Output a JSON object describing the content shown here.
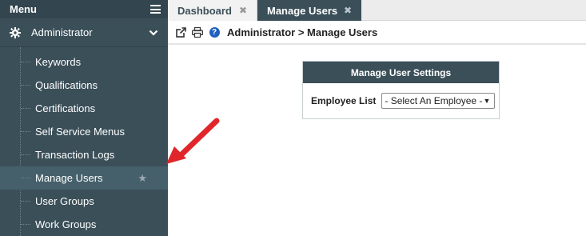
{
  "sidebar": {
    "title": "Menu",
    "section": "Administrator",
    "items": [
      {
        "label": "Keywords"
      },
      {
        "label": "Qualifications"
      },
      {
        "label": "Certifications"
      },
      {
        "label": "Self Service Menus"
      },
      {
        "label": "Transaction Logs"
      },
      {
        "label": "Manage Users",
        "active": true,
        "starred": true
      },
      {
        "label": "User Groups"
      },
      {
        "label": "Work Groups"
      }
    ]
  },
  "tabs": [
    {
      "label": "Dashboard",
      "active": false
    },
    {
      "label": "Manage Users",
      "active": true
    }
  ],
  "toolbar": {
    "icons": [
      "external-link-icon",
      "print-icon",
      "help-icon"
    ],
    "help_glyph": "?",
    "breadcrumb": "Administrator > Manage Users"
  },
  "panel": {
    "title": "Manage User Settings",
    "employee_label": "Employee List",
    "employee_select": "- Select An Employee -"
  },
  "colors": {
    "sidebar_bg": "#3b4f59",
    "active_item_bg": "#45606b",
    "accent_arrow": "#e0262b",
    "help_blue": "#1f5fbf"
  }
}
